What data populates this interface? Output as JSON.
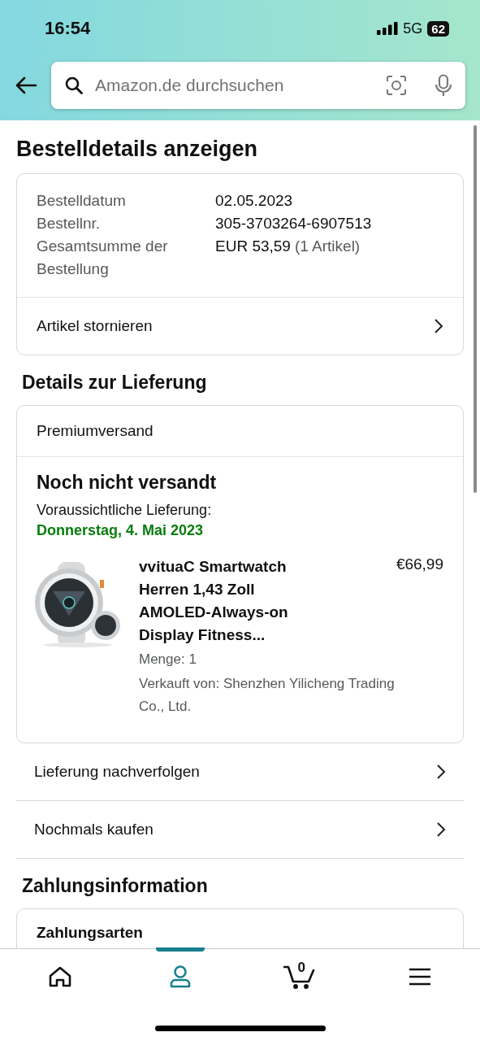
{
  "status_bar": {
    "time": "16:54",
    "network": "5G",
    "battery": "62"
  },
  "search": {
    "placeholder": "Amazon.de durchsuchen"
  },
  "page_title": "Bestelldetails anzeigen",
  "order_summary": {
    "rows": [
      {
        "label": "Bestelldatum",
        "value": "02.05.2023",
        "note": ""
      },
      {
        "label": "Bestellnr.",
        "value": "305-3703264-6907513",
        "note": ""
      },
      {
        "label": "Gesamtsumme der Bestellung",
        "value": "EUR 53,59",
        "note": "(1 Artikel)"
      }
    ],
    "action": "Artikel stornieren"
  },
  "delivery": {
    "heading": "Details zur Lieferung",
    "shipping": "Premiumversand",
    "status": "Noch nicht versandt",
    "eta_label": "Voraussichtliche Lieferung:",
    "eta_date": "Donnerstag, 4. Mai 2023",
    "item": {
      "kind": "picture",
      "title": "vvituaC Smartwatch Herren 1,43 Zoll AMOLED-Always-on Display Fitness...",
      "price": "€66,99",
      "quantity": "Menge: 1",
      "seller": "Verkauft von: Shenzhen Yilicheng Trading Co., Ltd."
    }
  },
  "actions": [
    "Lieferung nachverfolgen",
    "Nochmals kaufen"
  ],
  "payment": {
    "heading": "Zahlungsinformation",
    "section": "Zahlungsarten"
  },
  "bottom_nav": [
    {
      "kind": "home",
      "selected": false
    },
    {
      "kind": "account",
      "selected": true
    },
    {
      "kind": "cart",
      "selected": false,
      "count": "0"
    },
    {
      "kind": "menu",
      "selected": false
    }
  ]
}
